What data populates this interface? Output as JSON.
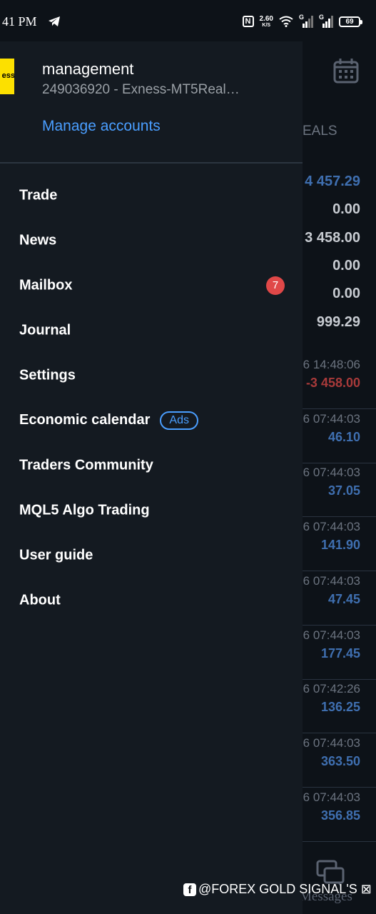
{
  "status_bar": {
    "time": "41 PM",
    "net_speed_value": "2.60",
    "net_speed_unit": "K/S",
    "sim_label": "G",
    "battery": "69"
  },
  "background": {
    "column_header": "EALS",
    "summary_values": [
      {
        "text": "4 457.29",
        "color": "#3f6fb0"
      },
      {
        "text": "0.00",
        "color": "#c8ccd2"
      },
      {
        "text": "3 458.00",
        "color": "#c8ccd2"
      },
      {
        "text": "0.00",
        "color": "#c8ccd2"
      },
      {
        "text": "0.00",
        "color": "#c8ccd2"
      },
      {
        "text": "999.29",
        "color": "#c8ccd2"
      }
    ],
    "deals": [
      {
        "time": "6 14:48:06",
        "value": "-3 458.00",
        "color": "#a83a3a"
      },
      {
        "time": "6 07:44:03",
        "value": "46.10",
        "color": "#3f6fb0"
      },
      {
        "time": "6 07:44:03",
        "value": "37.05",
        "color": "#3f6fb0"
      },
      {
        "time": "6 07:44:03",
        "value": "141.90",
        "color": "#3f6fb0"
      },
      {
        "time": "6 07:44:03",
        "value": "47.45",
        "color": "#3f6fb0"
      },
      {
        "time": "6 07:44:03",
        "value": "177.45",
        "color": "#3f6fb0"
      },
      {
        "time": "6 07:42:26",
        "value": "136.25",
        "color": "#3f6fb0"
      },
      {
        "time": "6 07:44:03",
        "value": "363.50",
        "color": "#3f6fb0"
      },
      {
        "time": "6 07:44:03",
        "value": "356.85",
        "color": "#3f6fb0"
      }
    ],
    "messages_label": "Messages"
  },
  "drawer": {
    "logo_text": "ess",
    "account_name": "management",
    "account_id": "249036920 - Exness-MT5Real…",
    "manage_accounts": "Manage accounts",
    "menu": [
      {
        "label": "Trade"
      },
      {
        "label": "News"
      },
      {
        "label": "Mailbox",
        "badge": "7"
      },
      {
        "label": "Journal"
      },
      {
        "label": "Settings"
      },
      {
        "label": "Economic calendar",
        "tag": "Ads"
      },
      {
        "label": "Traders Community"
      },
      {
        "label": "MQL5 Algo Trading"
      },
      {
        "label": "User guide"
      },
      {
        "label": "About"
      }
    ]
  },
  "watermark": {
    "text": "@FOREX GOLD SIGNAL'S ⊠"
  },
  "colors": {
    "accent": "#4a9eff",
    "badge": "#e04848",
    "drawer_bg": "#141a21",
    "logo_yellow": "#fce000"
  }
}
